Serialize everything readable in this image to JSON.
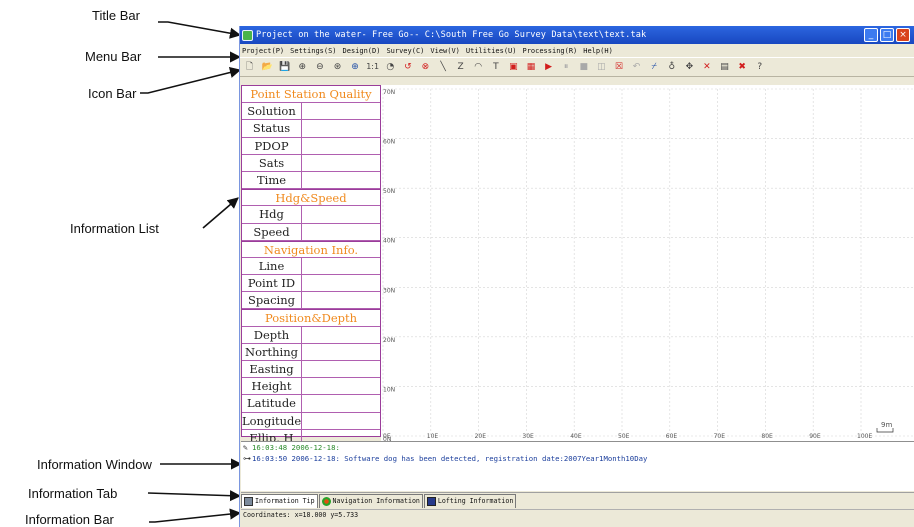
{
  "annotations": {
    "title_bar": "Title Bar",
    "menu_bar": "Menu Bar",
    "icon_bar": "Icon Bar",
    "information_list": "Information List",
    "information_window": "Information Window",
    "information_tab": "Information Tab",
    "information_bar": "Information Bar"
  },
  "window": {
    "title": "Project on the water- Free Go-- C:\\South Free Go Survey Data\\text\\text.tak",
    "controls": [
      "_",
      "□",
      "×"
    ]
  },
  "menu": {
    "items": [
      "Project(P)",
      "Settings(S)",
      "Design(D)",
      "Survey(C)",
      "View(V)",
      "Utilities(U)",
      "Processing(R)",
      "Help(H)"
    ]
  },
  "toolbar": {
    "icons": [
      {
        "name": "new-icon",
        "glyph": "🗋",
        "tone": ""
      },
      {
        "name": "open-icon",
        "glyph": "📂",
        "tone": ""
      },
      {
        "name": "save-icon",
        "glyph": "💾",
        "tone": "grey"
      },
      {
        "name": "zoom-in-icon",
        "glyph": "⊕",
        "tone": ""
      },
      {
        "name": "zoom-out-icon",
        "glyph": "⊖",
        "tone": ""
      },
      {
        "name": "zoom-window-icon",
        "glyph": "⊛",
        "tone": ""
      },
      {
        "name": "zoom-all-icon",
        "glyph": "⊕",
        "tone": "blue"
      },
      {
        "name": "zoom-1to1-icon",
        "glyph": "1:1",
        "tone": ""
      },
      {
        "name": "pan-icon",
        "glyph": "◔",
        "tone": ""
      },
      {
        "name": "redraw-icon",
        "glyph": "↺",
        "tone": "red"
      },
      {
        "name": "stop-draw-icon",
        "glyph": "⊗",
        "tone": "red"
      },
      {
        "name": "line-icon",
        "glyph": "╲",
        "tone": ""
      },
      {
        "name": "polyline-icon",
        "glyph": "Z",
        "tone": ""
      },
      {
        "name": "arc-icon",
        "glyph": "◠",
        "tone": ""
      },
      {
        "name": "text-icon",
        "glyph": "T",
        "tone": ""
      },
      {
        "name": "point-icon",
        "glyph": "▣",
        "tone": "red"
      },
      {
        "name": "grid-icon",
        "glyph": "▦",
        "tone": "red"
      },
      {
        "name": "play-icon",
        "glyph": "▶",
        "tone": "play"
      },
      {
        "name": "pause-icon",
        "glyph": "⏸",
        "tone": "grey"
      },
      {
        "name": "stop-icon",
        "glyph": "■",
        "tone": "grey"
      },
      {
        "name": "record-icon",
        "glyph": "◫",
        "tone": "grey"
      },
      {
        "name": "mark-icon",
        "glyph": "☒",
        "tone": "red"
      },
      {
        "name": "undo-icon",
        "glyph": "↶",
        "tone": "grey"
      },
      {
        "name": "check-line-icon",
        "glyph": "⌿",
        "tone": "blue"
      },
      {
        "name": "measure-icon",
        "glyph": "♁",
        "tone": ""
      },
      {
        "name": "move-icon",
        "glyph": "✥",
        "tone": ""
      },
      {
        "name": "delete-icon",
        "glyph": "✕",
        "tone": "red"
      },
      {
        "name": "calc-icon",
        "glyph": "▤",
        "tone": ""
      },
      {
        "name": "tools-icon",
        "glyph": "✖",
        "tone": "red"
      },
      {
        "name": "help-icon",
        "glyph": "?",
        "tone": ""
      }
    ]
  },
  "info_list": {
    "sections": [
      {
        "header": "Point Station Quality",
        "rows": [
          "Solution",
          "Status",
          "PDOP",
          "Sats",
          "Time"
        ]
      },
      {
        "header": "Hdg&Speed",
        "rows": [
          "Hdg",
          "Speed"
        ]
      },
      {
        "header": "Navigation Info.",
        "rows": [
          "Line",
          "Point ID",
          "Spacing"
        ]
      },
      {
        "header": "Position&Depth",
        "rows": [
          "Depth",
          "Northing",
          "Easting",
          "Height",
          "Latitude",
          "Longitude",
          "Ellip. H"
        ]
      }
    ]
  },
  "plot": {
    "y_labels": [
      "70N",
      "60N",
      "50N",
      "40N",
      "30N",
      "20N",
      "10N",
      "0N"
    ],
    "x_labels": [
      "0E",
      "10E",
      "20E",
      "30E",
      "40E",
      "50E",
      "60E",
      "70E",
      "80E",
      "90E",
      "100E"
    ],
    "scale_label": "9m"
  },
  "info_window": {
    "lines": [
      {
        "icon": "pen-icon",
        "text": "16:03:48 2006-12-18:",
        "tone": "green"
      },
      {
        "icon": "link-icon",
        "text": "16:03:50 2006-12-18: Software dog has been detected, registration date:2007Year1Month10Day",
        "tone": "blue"
      }
    ]
  },
  "tabs": [
    {
      "label": "Information Tip",
      "icon": "doc",
      "active": true
    },
    {
      "label": "Navigation Information",
      "icon": "nav",
      "active": false
    },
    {
      "label": "Lofting Information",
      "icon": "loft",
      "active": false
    }
  ],
  "status": {
    "coordinates": "Coordinates: x=18.000 y=5.733"
  }
}
